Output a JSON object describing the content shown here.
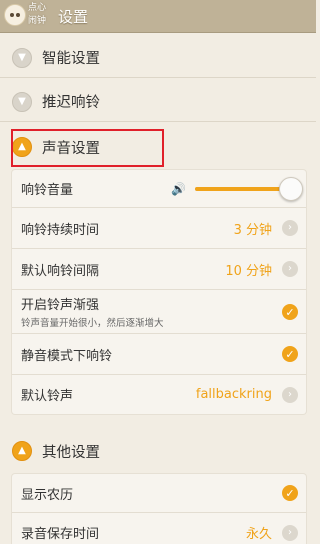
{
  "app": {
    "logo_text": "点心闹钟",
    "title": "设置"
  },
  "sections": [
    {
      "label": "智能设置",
      "state": "collapsed"
    },
    {
      "label": "推迟响铃",
      "state": "collapsed"
    },
    {
      "label": "声音设置",
      "state": "expanded"
    },
    {
      "label": "其他设置",
      "state": "expanded"
    }
  ],
  "sound": {
    "ring_volume": {
      "label": "响铃音量",
      "level_fraction": 1.0
    },
    "ring_duration": {
      "label": "响铃持续时间",
      "value": "3 分钟"
    },
    "default_interval": {
      "label": "默认响铃间隔",
      "value": "10 分钟"
    },
    "gradual_volume": {
      "label": "开启铃声渐强",
      "sub": "铃声音量开始很小，然后逐渐增大",
      "checked": true
    },
    "ring_in_silent": {
      "label": "静音模式下响铃",
      "checked": true
    },
    "default_ringtone": {
      "label": "默认铃声",
      "value": "fallbackring"
    }
  },
  "other": {
    "show_lunar": {
      "label": "显示农历",
      "checked": true
    },
    "record_keep_time": {
      "label": "录音保存时间",
      "value": "永久"
    }
  },
  "colors": {
    "accent": "#f0a31a",
    "titlebar": "#bfb297",
    "highlight": "#e0202a"
  }
}
